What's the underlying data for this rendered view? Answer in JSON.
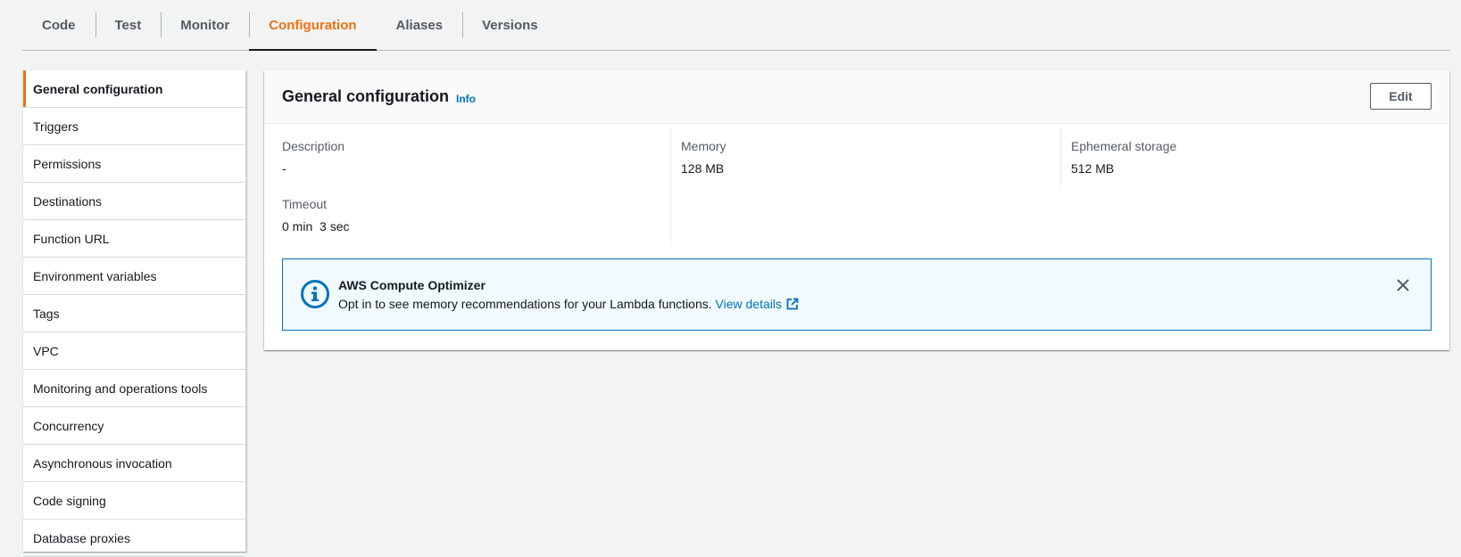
{
  "tabs": [
    {
      "label": "Code"
    },
    {
      "label": "Test"
    },
    {
      "label": "Monitor"
    },
    {
      "label": "Configuration",
      "active": true
    },
    {
      "label": "Aliases"
    },
    {
      "label": "Versions"
    }
  ],
  "sidenav": {
    "items": [
      {
        "label": "General configuration",
        "active": true
      },
      {
        "label": "Triggers"
      },
      {
        "label": "Permissions"
      },
      {
        "label": "Destinations"
      },
      {
        "label": "Function URL"
      },
      {
        "label": "Environment variables"
      },
      {
        "label": "Tags"
      },
      {
        "label": "VPC"
      },
      {
        "label": "Monitoring and operations tools"
      },
      {
        "label": "Concurrency"
      },
      {
        "label": "Asynchronous invocation"
      },
      {
        "label": "Code signing"
      },
      {
        "label": "Database proxies"
      }
    ]
  },
  "panel": {
    "title": "General configuration",
    "info_label": "Info",
    "edit_label": "Edit",
    "fields": {
      "description": {
        "label": "Description",
        "value": "-"
      },
      "memory": {
        "label": "Memory",
        "value": "128 MB"
      },
      "ephemeral_storage": {
        "label": "Ephemeral storage",
        "value": "512 MB"
      },
      "timeout": {
        "label": "Timeout",
        "value": "0 min  3 sec"
      }
    },
    "alert": {
      "title": "AWS Compute Optimizer",
      "body": "Opt in to see memory recommendations for your Lambda functions.",
      "link_label": "View details"
    }
  },
  "colors": {
    "accent": "#ec7211",
    "link": "#0073bb",
    "alert_bg": "#f1faff"
  },
  "icons": {
    "alert": "info-circle-icon",
    "external": "external-link-icon",
    "close": "close-icon"
  }
}
